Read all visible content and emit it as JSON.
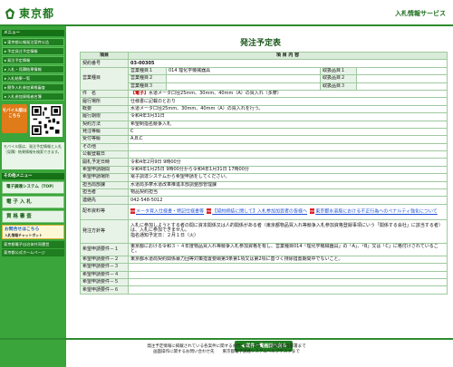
{
  "header": {
    "logo_text": "東京都",
    "site_title": "入札情報サービス"
  },
  "sidebar": {
    "menu_title": "メニュー",
    "menu_items": [
      "東京都公報発注案件公告",
      "予定発注予定情報",
      "発注予定情報",
      "入札・見積結果情報",
      "入札結果一覧",
      "競争入札参加資格審査",
      "入札参加資格者名簿"
    ],
    "mobile_button": "モバイル版はこちら",
    "mobile_note": "モバイル版は、発注予定情報と入札（見積）結果情報を検索できます。",
    "other_menu_title": "その他メニュー",
    "buttons": [
      "電子調達システム（TOP）",
      "電 子 入 札",
      "資 格 審 査"
    ],
    "faq_label": "お問合せはこちら",
    "faq_sub": "入札情報チャットボット",
    "links": [
      "東京都電子自治体共同運営",
      "東京都公式ホームページ"
    ]
  },
  "main": {
    "title": "発注予定表",
    "table_header": {
      "item": "項目",
      "content": "項 目 内 容"
    },
    "contract_no_label": "契約番号",
    "contract_no": "03-00305",
    "business_types_label": "営業種目",
    "business_types": [
      {
        "label": "営業種目１",
        "value": "014 理化学機械器具",
        "rank_label": "取扱品目１",
        "rank": ""
      },
      {
        "label": "営業種目２",
        "value": "",
        "rank_label": "取扱品目２",
        "rank": ""
      },
      {
        "label": "営業種目３",
        "value": "",
        "rank_label": "取扱品目３",
        "rank": ""
      }
    ],
    "subject_label": "件　名",
    "subject_tag": "【電子】",
    "subject_text": "水道メータ口径25mm、30mm、40mm（A）の買入れ（多摩）",
    "rows": [
      {
        "label": "履行場所",
        "value": "仕様書に記載のとおり"
      },
      {
        "label": "概要",
        "value": "水道メータ口径25mm、30mm、40mm（A）の買入れを行う。"
      },
      {
        "label": "履行期限",
        "value": "令和4年3月31日"
      },
      {
        "label": "契約方法",
        "value": "希望制指名競争入札"
      },
      {
        "label": "発注等級",
        "value": "C"
      },
      {
        "label": "受付等級",
        "value": "A,B,C"
      },
      {
        "label": "その他",
        "value": ""
      },
      {
        "label": "公報登載日",
        "value": ""
      },
      {
        "label": "開札予定日時",
        "value": "令和4年2月9日 9時00分"
      },
      {
        "label": "希望申請期間",
        "value": "令和4年1月25日 9時00分から令和4年1月31日 17時00分"
      },
      {
        "label": "希望申請場所",
        "value": "電子調達システムから希望申請をしてください。"
      },
      {
        "label": "担当局部課",
        "value": "水道局多摩水道改革推進本部調整部管理課"
      },
      {
        "label": "担当者",
        "value": "物品契約担当"
      },
      {
        "label": "連絡先",
        "value": "042-548-5012"
      }
    ],
    "docs_label": "配布資料等",
    "docs": [
      "メータ買入仕様書・特記仕様書等",
      "【契約締結に関して】入札参加加資者の皆様へ",
      "東京都水道局における不正行為へのペナルティ強化について"
    ],
    "condition_label": "発注方針等",
    "conditions": [
      "入札に参加しようとする者の間に資本関係又は人的関係がある者（東京都物品買入れ等競争入札参加資格登録事項にいう「関係する会社」に該当する者）は、入札に参加できません。",
      "指名通知予定日：２月１日（火）"
    ],
    "req_rows": [
      {
        "label": "希望申請要件－１",
        "value": "東京都における令和３・４年度物品買入れ等競争入札参加資格を有し、営業種目014「理化学機械器具」の「A」、「B」又は「C」に格付けされていること。"
      },
      {
        "label": "希望申請要件－２",
        "value": "東京都水道局契約関係暴力団等対策措置要綱第3条第1項又は第2項に基づく排除措置期間中でないこと。"
      },
      {
        "label": "希望申請要件－３",
        "value": ""
      },
      {
        "label": "希望申請要件－４",
        "value": ""
      },
      {
        "label": "希望申請要件－５",
        "value": ""
      },
      {
        "label": "希望申請要件－６",
        "value": ""
      }
    ],
    "back_button": "案件一覧画面へ戻る"
  },
  "footer": {
    "line1": "発注予定情報に掲載されている各案件に関するお問い合わせ先　　各局所担当部署まで",
    "line2": "画面操作に関するお問い合わせ先　　東京都電子調達システムヘルプデスクまで"
  },
  "colors": {
    "brand_green": "#2e8b2e",
    "sidebar_green": "#3aa53a",
    "accent_red": "#c00000",
    "link_blue": "#1a4fd6"
  }
}
